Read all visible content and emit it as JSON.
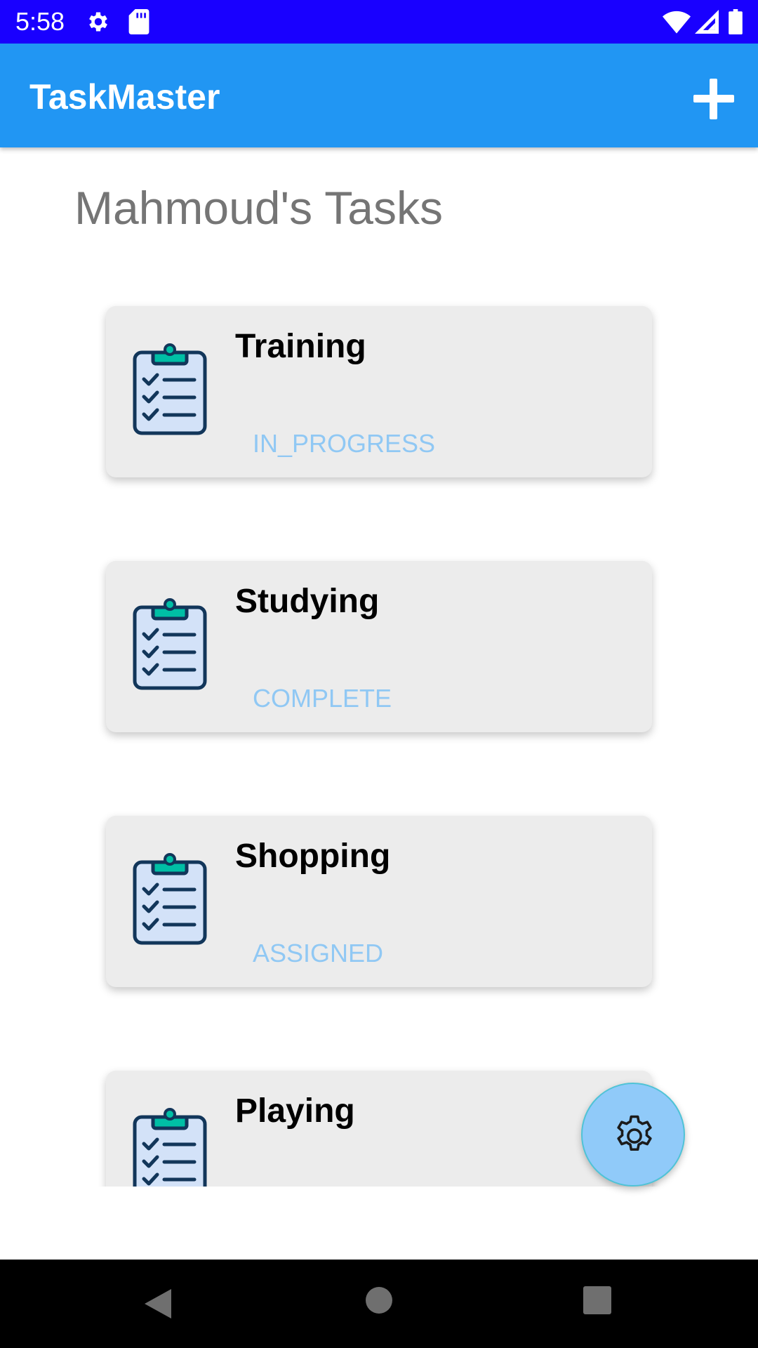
{
  "status_bar": {
    "time": "5:58",
    "left_icons": [
      "gear-icon",
      "sd-card-icon"
    ],
    "right_icons": [
      "wifi-icon",
      "signal-icon",
      "battery-icon"
    ],
    "background": "#1900ff"
  },
  "app_bar": {
    "title": "TaskMaster",
    "action_icon": "plus-icon",
    "background": "#2196f3"
  },
  "page": {
    "heading": "Mahmoud's Tasks"
  },
  "tasks": [
    {
      "title": "Training",
      "status": "IN_PROGRESS",
      "icon": "clipboard-checklist-icon"
    },
    {
      "title": "Studying",
      "status": "COMPLETE",
      "icon": "clipboard-checklist-icon"
    },
    {
      "title": "Shopping",
      "status": "ASSIGNED",
      "icon": "clipboard-checklist-icon"
    },
    {
      "title": "Playing",
      "status": "",
      "icon": "clipboard-checklist-icon"
    }
  ],
  "fab": {
    "icon": "settings-icon",
    "background": "#90caf9"
  },
  "nav_bar": {
    "buttons": [
      "back-icon",
      "home-icon",
      "recents-icon"
    ]
  },
  "colors": {
    "status_text": "#90c8f4",
    "card_background": "#ececec",
    "heading_text": "#757575"
  }
}
